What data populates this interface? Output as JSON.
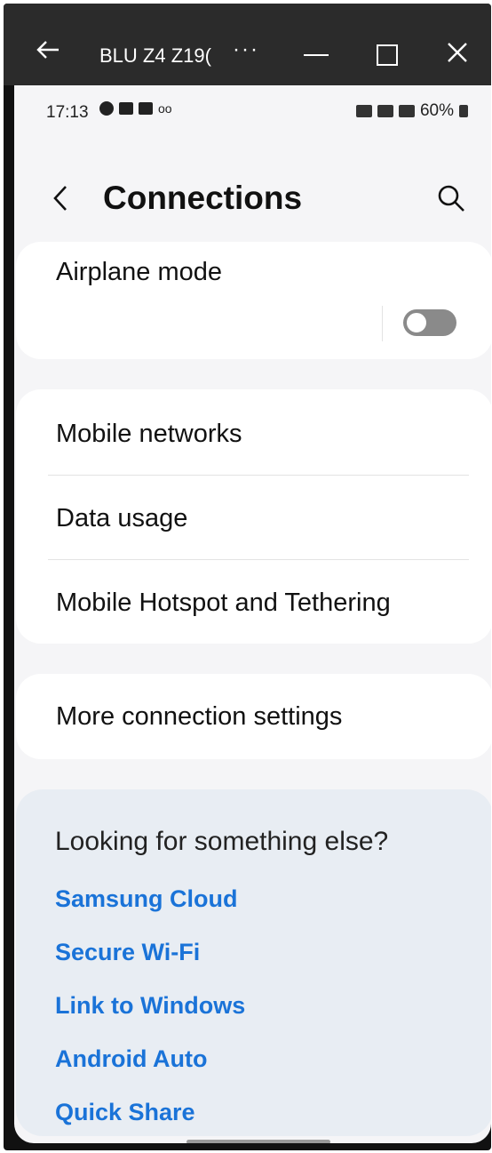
{
  "window": {
    "title": "BLU Z4 Z19(",
    "more_label": "···"
  },
  "status_bar": {
    "time": "17:13",
    "voicemail": "oo",
    "battery": "60%"
  },
  "header": {
    "title": "Connections"
  },
  "airplane": {
    "label": "Airplane mode",
    "enabled": false
  },
  "network_items": [
    {
      "label": "Mobile networks"
    },
    {
      "label": "Data usage"
    },
    {
      "label": "Mobile Hotspot and Tethering"
    }
  ],
  "more_settings": {
    "label": "More connection settings"
  },
  "suggestions": {
    "title": "Looking for something else?",
    "links": [
      {
        "label": "Samsung Cloud"
      },
      {
        "label": "Secure Wi-Fi"
      },
      {
        "label": "Link to Windows"
      },
      {
        "label": "Android Auto"
      },
      {
        "label": "Quick Share"
      }
    ],
    "link_color": "#1a73d8"
  }
}
